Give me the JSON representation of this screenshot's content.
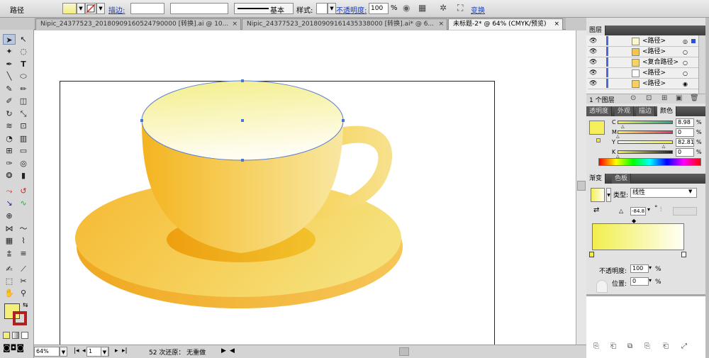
{
  "control_bar": {
    "object_type": "路径",
    "stroke_label": "描边:",
    "stroke_profile": "基本",
    "style_label": "样式:",
    "opacity_label": "不透明度:",
    "opacity_value": "100",
    "opacity_unit": "%",
    "transform_label": "变换"
  },
  "tabs": [
    {
      "label": "Nipic_24377523_20180909160524790000 [转换].ai @ 10...",
      "active": false
    },
    {
      "label": "Nipic_24377523_20180909161435338000 [转换].ai* @ 6...",
      "active": false
    },
    {
      "label": "未标题-2* @ 64% (CMYK/预览)",
      "active": true
    }
  ],
  "tab_close": "×",
  "status_bar": {
    "zoom": "64%",
    "page": "1",
    "undo_status": "52 次还原： 无重做"
  },
  "layers_panel": {
    "title": "图层",
    "items": [
      {
        "name": "<路径>"
      },
      {
        "name": "<路径>"
      },
      {
        "name": "<复合路径>"
      },
      {
        "name": "<路径>"
      },
      {
        "name": "<路径>"
      }
    ],
    "count": "1 个图层"
  },
  "color_panel": {
    "tabs": [
      "透明度",
      "外观",
      "描边",
      "颜色"
    ],
    "active_tab": "颜色",
    "channels": [
      {
        "label": "C",
        "value": "8.98",
        "percent": 8.98
      },
      {
        "label": "M",
        "value": "0",
        "percent": 0
      },
      {
        "label": "Y",
        "value": "82.81",
        "percent": 82.81
      },
      {
        "label": "K",
        "value": "0",
        "percent": 0
      }
    ],
    "unit": "%"
  },
  "gradient_panel": {
    "tabs": [
      "渐变",
      "色板"
    ],
    "active_tab": "渐变",
    "type_label": "类型:",
    "type_value": "线性",
    "angle_value": "-84.8",
    "angle_unit": "°",
    "opacity_label": "不透明度:",
    "opacity_value": "100",
    "opacity_unit": "%",
    "location_label": "位置:",
    "location_value": "0",
    "location_unit": "%"
  },
  "colors": {
    "cup_yellow": "#f6c230",
    "fill_swatch": "#f4ef7a"
  }
}
